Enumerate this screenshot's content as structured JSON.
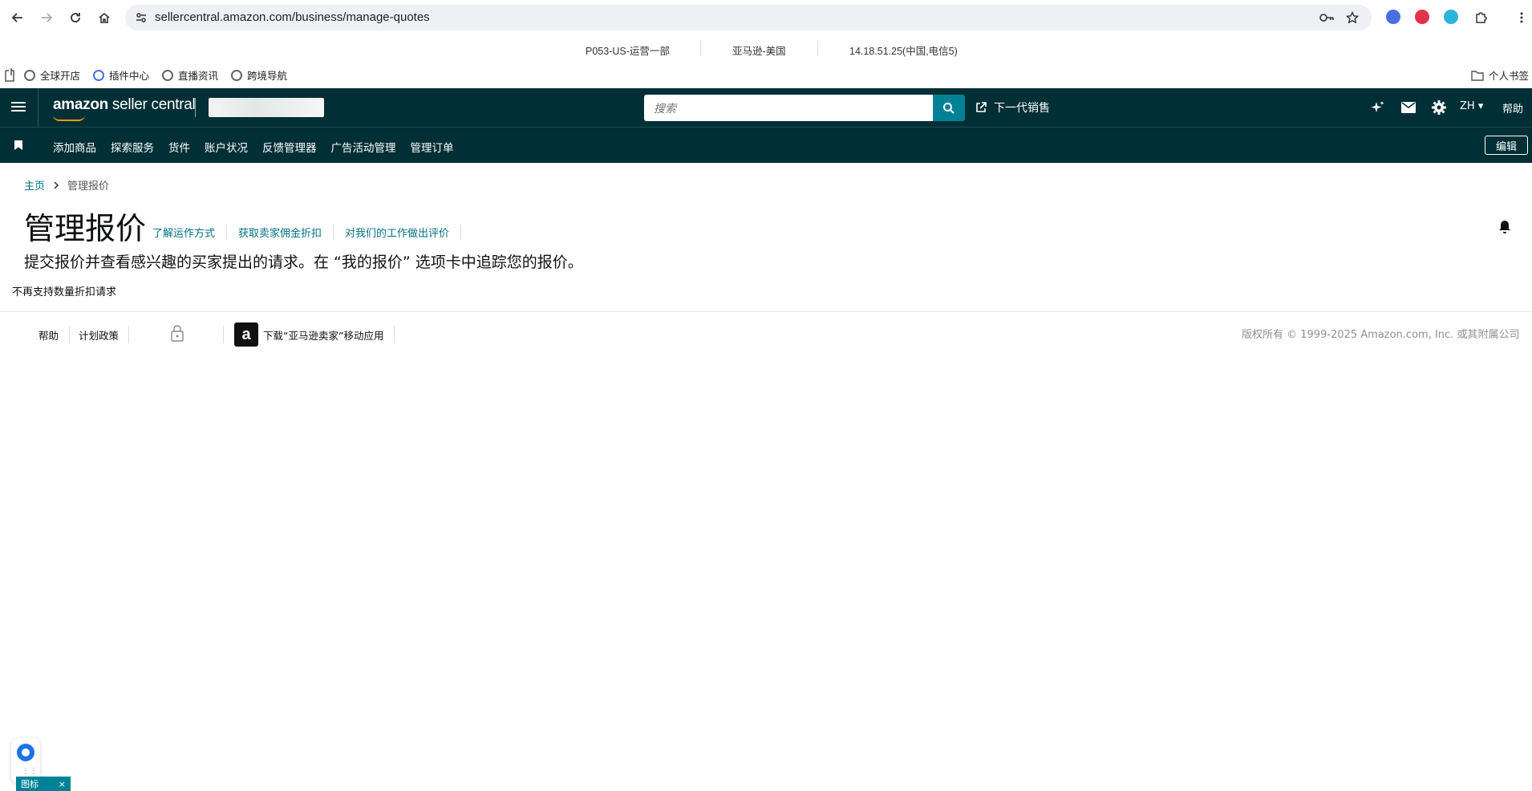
{
  "browser": {
    "url": "sellercentral.amazon.com/business/manage-quotes",
    "info_bar": [
      "P053-US-运营一部",
      "亚马逊-美国",
      "14.18.51.25(中国,电信5)"
    ],
    "bookmarks": [
      "全球开店",
      "插件中心",
      "直播资讯",
      "跨境导航"
    ],
    "bookmark_folder": "个人书签"
  },
  "header": {
    "logo_bold": "amazon",
    "logo_rest": " seller central",
    "search_placeholder": "搜索",
    "next_sales": "下一代销售",
    "lang": "ZH",
    "help": "帮助",
    "accent": "#008296",
    "bg": "#002f36"
  },
  "nav": {
    "items": [
      "添加商品",
      "探索服务",
      "货件",
      "账户状况",
      "反馈管理器",
      "广告活动管理",
      "管理订单"
    ],
    "edit": "编辑"
  },
  "breadcrumb": {
    "home": "主页",
    "current": "管理报价"
  },
  "page": {
    "title": "管理报价",
    "links": [
      "了解运作方式",
      "获取卖家佣金折扣",
      "对我们的工作做出评价"
    ],
    "subtitle": "提交报价并查看感兴趣的买家提出的请求。在 “我的报价” 选项卡中追踪您的报价。",
    "notice": "不再支持数量折扣请求"
  },
  "footer": {
    "help": "帮助",
    "policy": "计划政策",
    "app_download": "下载“亚马逊卖家”移动应用",
    "copyright": "版权所有 © 1999-2025 Amazon.com, Inc. 或其附属公司"
  },
  "widget": {
    "bottom_tab": "图标",
    "close": "×"
  }
}
